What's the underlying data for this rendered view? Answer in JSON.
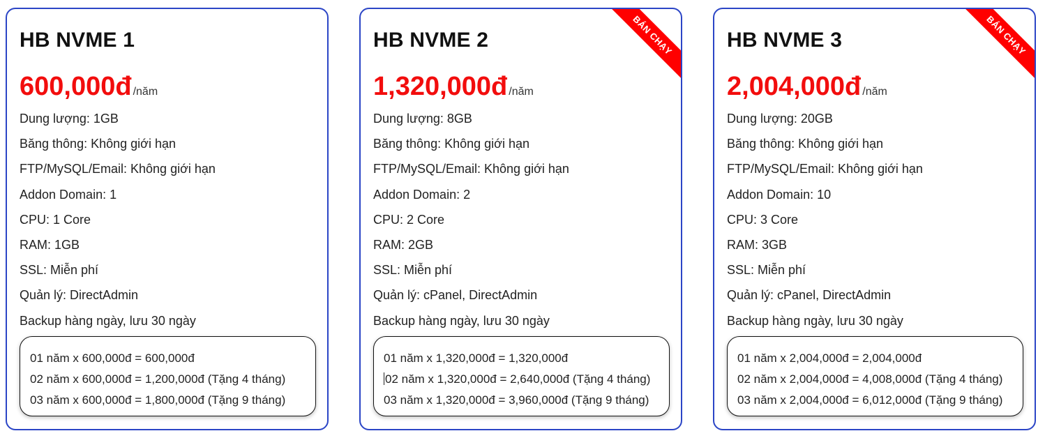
{
  "cards": [
    {
      "title": "HB NVME 1",
      "price": "600,000đ",
      "period": "/năm",
      "badge": "",
      "features": [
        "Dung lượng: 1GB",
        "Băng thông: Không giới hạn",
        "FTP/MySQL/Email: Không giới hạn",
        "Addon Domain: 1",
        "CPU: 1 Core",
        "RAM: 1GB",
        "SSL: Miễn phí",
        "Quản lý: DirectAdmin",
        "Backup hàng ngày, lưu 30 ngày"
      ],
      "pricing": [
        "01 năm x 600,000đ = 600,000đ",
        "02 năm x 600,000đ = 1,200,000đ (Tặng 4 tháng)",
        "03 năm x 600,000đ = 1,800,000đ (Tặng 9 tháng)"
      ]
    },
    {
      "title": "HB NVME 2",
      "price": "1,320,000đ",
      "period": "/năm",
      "badge": "BÁN CHẠY",
      "features": [
        "Dung lượng: 8GB",
        "Băng thông: Không giới hạn",
        "FTP/MySQL/Email: Không giới hạn",
        "Addon Domain: 2",
        "CPU: 2 Core",
        "RAM: 2GB",
        "SSL: Miễn phí",
        "Quản lý: cPanel, DirectAdmin",
        "Backup hàng ngày, lưu 30 ngày"
      ],
      "pricing": [
        "01 năm x 1,320,000đ = 1,320,000đ",
        "02 năm x 1,320,000đ = 2,640,000đ (Tặng 4 tháng)",
        "03 năm x 1,320,000đ = 3,960,000đ (Tặng 9 tháng)"
      ]
    },
    {
      "title": "HB NVME 3",
      "price": "2,004,000đ",
      "period": "/năm",
      "badge": "BÁN CHẠY",
      "features": [
        "Dung lượng: 20GB",
        "Băng thông: Không giới hạn",
        "FTP/MySQL/Email: Không giới hạn",
        "Addon Domain: 10",
        "CPU: 3 Core",
        "RAM: 3GB",
        "SSL: Miễn phí",
        "Quản lý: cPanel, DirectAdmin",
        "Backup hàng ngày, lưu 30 ngày"
      ],
      "pricing": [
        "01 năm x 2,004,000đ = 2,004,000đ",
        "02 năm x 2,004,000đ = 4,008,000đ (Tặng 4 tháng)",
        "03 năm x 2,004,000đ = 6,012,000đ (Tặng 9 tháng)"
      ]
    }
  ],
  "colors": {
    "border": "#2b45c6",
    "price": "#f20d0d",
    "ribbon": "#ff0000"
  }
}
